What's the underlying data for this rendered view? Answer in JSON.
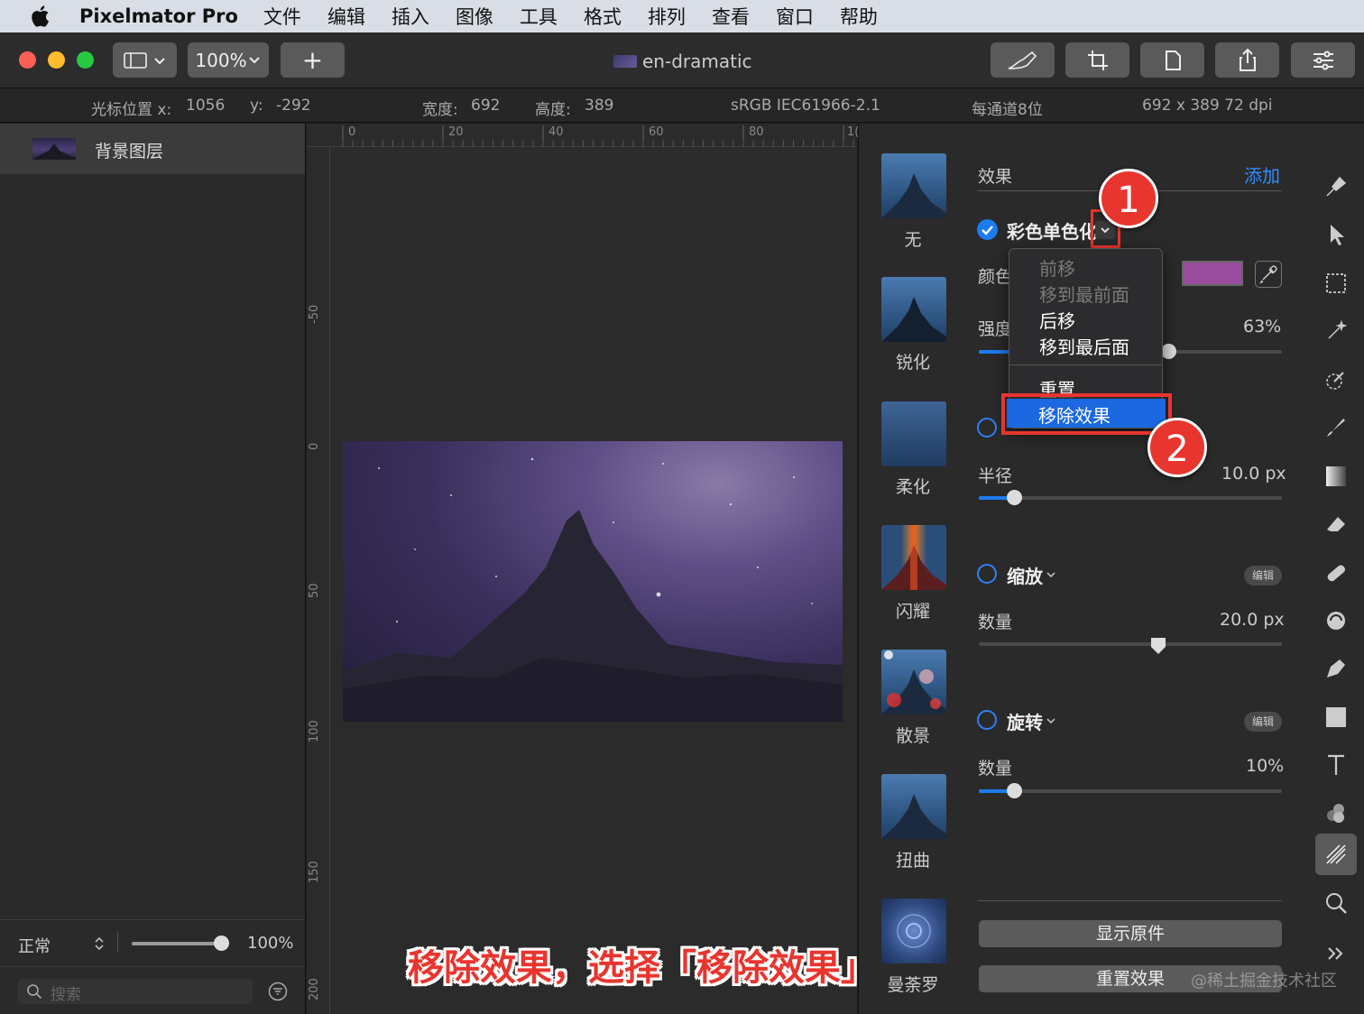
{
  "menubar": {
    "app_name": "Pixelmator Pro",
    "items": [
      "文件",
      "编辑",
      "插入",
      "图像",
      "工具",
      "格式",
      "排列",
      "查看",
      "窗口",
      "帮助"
    ]
  },
  "toolbar": {
    "zoom": "100%",
    "add_label": "+",
    "doc_title": "en-dramatic"
  },
  "infobar": {
    "cursor_x_label": "光标位置 x:",
    "cursor_x": "1056",
    "cursor_y_label": "y:",
    "cursor_y": "-292",
    "width_label": "宽度:",
    "width": "692",
    "height_label": "高度:",
    "height": "389",
    "color_profile": "sRGB IEC61966-2.1",
    "bit_depth": "每通道8位",
    "size_dpi": "692 x 389 72 dpi"
  },
  "layers": {
    "items": [
      {
        "name": "背景图层"
      }
    ],
    "blend_mode": "正常",
    "opacity": "100%",
    "search_placeholder": "搜索"
  },
  "rulers": {
    "horizontal": [
      "0",
      "20",
      "40",
      "60",
      "80",
      "1("
    ],
    "vertical": [
      "-50",
      "0",
      "50",
      "100",
      "150",
      "200"
    ]
  },
  "effects_browser": {
    "items": [
      "无",
      "锐化",
      "柔化",
      "闪耀",
      "散景",
      "扭曲",
      "曼荼罗"
    ]
  },
  "effects_panel": {
    "header": "效果",
    "add": "添加",
    "effect1": {
      "name": "彩色单色化",
      "checked": true,
      "color_label": "颜色",
      "color": "#9a4c9f",
      "strength_label": "强度",
      "strength": "63%"
    },
    "effect2": {
      "radius_label": "半径",
      "radius": "10.0 px"
    },
    "effect3": {
      "name": "缩放",
      "edit": "编辑",
      "amount_label": "数量",
      "amount": "20.0 px"
    },
    "effect4": {
      "name": "旋转",
      "edit": "编辑",
      "amount_label": "数量",
      "amount": "10%"
    },
    "show_original": "显示原件",
    "reset_effects": "重置效果"
  },
  "context_menu": {
    "items": [
      "前移",
      "移到最前面",
      "后移",
      "移到最后面",
      "重置",
      "移除效果"
    ]
  },
  "annotations": {
    "badge1": "1",
    "badge2": "2",
    "caption": "移除效果，选择「移除效果」",
    "watermark": "@稀土掘金技术社区"
  },
  "colors": {
    "accent": "#1b7cf2",
    "highlight_red": "#e8352e",
    "swatch": "#9a4c9f"
  }
}
